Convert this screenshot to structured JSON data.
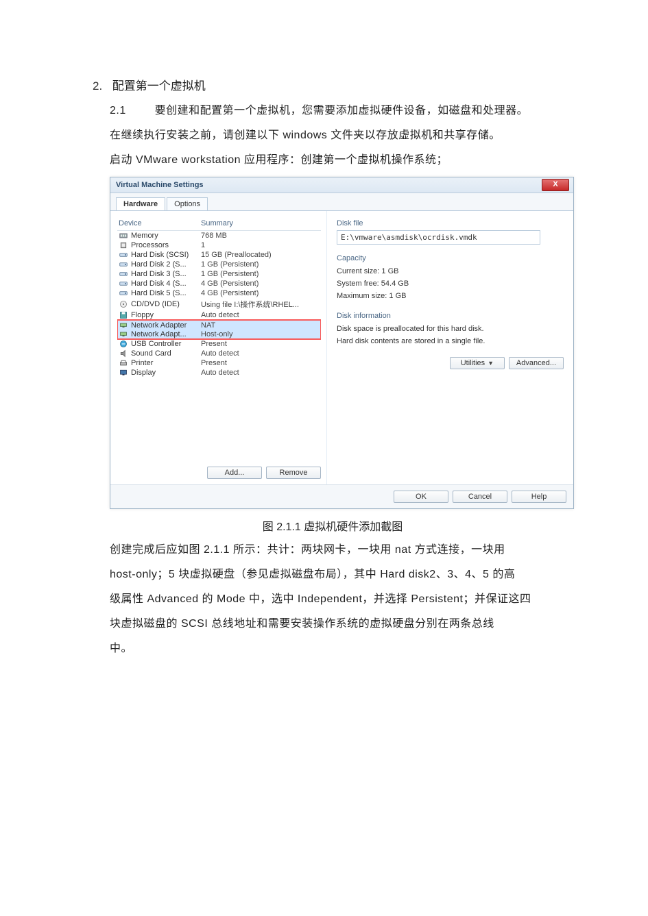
{
  "doc": {
    "sec_num": "2.",
    "sec_title": "配置第一个虚拟机",
    "p1_lead": "2.1",
    "p1a": "要创建和配置第一个虚拟机，您需要添加虚拟硬件设备，如磁盘和处理器。",
    "p1b": "在继续执行安装之前，请创建以下 windows 文件夹以存放虚拟机和共享存储。",
    "p1c": "启动 VMware  workstation 应用程序：创建第一个虚拟机操作系统；",
    "caption": "图 2.1.1 虚拟机硬件添加截图",
    "p2a": "创建完成后应如图 2.1.1 所示：共计：两块网卡，一块用 nat 方式连接，一块用",
    "p2b": "host-only；5 块虚拟硬盘（参见虚拟磁盘布局），其中 Hard disk2、3、4、5 的高",
    "p2c": "级属性 Advanced 的 Mode 中，选中 Independent，并选择 Persistent；并保证这四",
    "p2d": "块虚拟磁盘的 SCSI 总线地址和需要安装操作系统的虚拟硬盘分别在两条总线",
    "p2e": "中。"
  },
  "dlg": {
    "title": "Virtual Machine Settings",
    "close_x": "X",
    "tabs": {
      "hardware": "Hardware",
      "options": "Options"
    },
    "cols": {
      "device": "Device",
      "summary": "Summary"
    },
    "rows": {
      "memory": {
        "name": "Memory",
        "summary": "768 MB"
      },
      "processors": {
        "name": "Processors",
        "summary": "1"
      },
      "hd1": {
        "name": "Hard Disk (SCSI)",
        "summary": "15 GB (Preallocated)"
      },
      "hd2": {
        "name": "Hard Disk 2 (S...",
        "summary": "1 GB (Persistent)"
      },
      "hd3": {
        "name": "Hard Disk 3 (S...",
        "summary": "1 GB (Persistent)"
      },
      "hd4": {
        "name": "Hard Disk 4 (S...",
        "summary": "4 GB (Persistent)"
      },
      "hd5": {
        "name": "Hard Disk 5 (S...",
        "summary": "4 GB (Persistent)"
      },
      "cd": {
        "name": "CD/DVD (IDE)",
        "summary": "Using file I:\\操作系统\\RHEL..."
      },
      "floppy": {
        "name": "Floppy",
        "summary": "Auto detect"
      },
      "net1": {
        "name": "Network Adapter",
        "summary": "NAT"
      },
      "net2": {
        "name": "Network Adapt...",
        "summary": "Host-only"
      },
      "usb": {
        "name": "USB Controller",
        "summary": "Present"
      },
      "sound": {
        "name": "Sound Card",
        "summary": "Auto detect"
      },
      "printer": {
        "name": "Printer",
        "summary": "Present"
      },
      "display": {
        "name": "Display",
        "summary": "Auto detect"
      }
    },
    "buttons": {
      "add": "Add...",
      "remove": "Remove",
      "ok": "OK",
      "cancel": "Cancel",
      "help": "Help",
      "utilities": "Utilities",
      "advanced": "Advanced..."
    },
    "right": {
      "diskfile_title": "Disk file",
      "diskfile_path": "E:\\vmware\\asmdisk\\ocrdisk.vmdk",
      "capacity_title": "Capacity",
      "current_size": "Current size: 1 GB",
      "system_free": "System free: 54.4 GB",
      "max_size": "Maximum size: 1 GB",
      "diskinfo_title": "Disk information",
      "info1": "Disk space is preallocated for this hard disk.",
      "info2": "Hard disk contents are stored in a single file."
    }
  }
}
